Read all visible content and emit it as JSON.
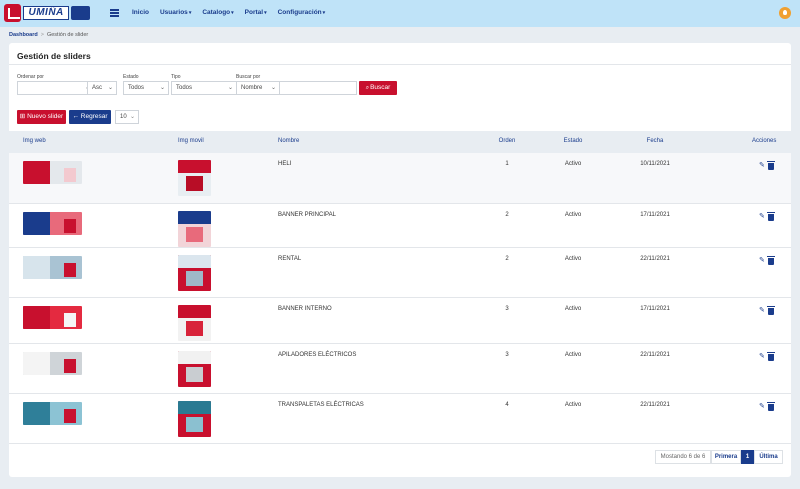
{
  "brand": {
    "logo_text": "UMIÑA"
  },
  "nav": [
    {
      "label": "Inicio",
      "caret": false
    },
    {
      "label": "Usuarios",
      "caret": true
    },
    {
      "label": "Catalogo",
      "caret": true
    },
    {
      "label": "Portal",
      "caret": true
    },
    {
      "label": "Configuración",
      "caret": true
    }
  ],
  "breadcrumb": {
    "root": "Dashboard",
    "current": "Gestión de slider"
  },
  "page": {
    "title": "Gestión de sliders"
  },
  "filters": {
    "order_label": "Ordenar por",
    "order_value": "",
    "order_dir": "Asc",
    "estado_label": "Estado",
    "estado_value": "Todos",
    "tipo_label": "Tipo",
    "tipo_value": "Todos",
    "buscar_label": "Buscar por",
    "buscar_field": "Nombre",
    "search_value": "",
    "search_button": "Buscar"
  },
  "actions": {
    "new_label": "Nuevo slider",
    "back_label": "Regresar",
    "page_size": "10"
  },
  "table": {
    "headers": [
      "Img web",
      "Img movil",
      "Nombre",
      "Orden",
      "Estado",
      "Fecha",
      "Acciones"
    ],
    "rows": [
      {
        "nombre": "HELI",
        "orden": "1",
        "estado": "Activo",
        "fecha": "10/11/2021",
        "web_colors": [
          "#c8102e",
          "#e4e8ec",
          "#f3c9cf"
        ],
        "mov_colors": [
          "#c8102e",
          "#b80d26",
          "#e8eef2"
        ]
      },
      {
        "nombre": "BANNER PRINCIPAL",
        "orden": "2",
        "estado": "Activo",
        "fecha": "17/11/2021",
        "web_colors": [
          "#1a3c8c",
          "#e86a7b",
          "#c8102e"
        ],
        "mov_colors": [
          "#1a3c8c",
          "#e86a7b",
          "#f2d4d8"
        ]
      },
      {
        "nombre": "RENTAL",
        "orden": "2",
        "estado": "Activo",
        "fecha": "22/11/2021",
        "web_colors": [
          "#d7e4ec",
          "#a9c3d3",
          "#c8102e"
        ],
        "mov_colors": [
          "#dbe6ee",
          "#9fb8c8",
          "#c8102e"
        ]
      },
      {
        "nombre": "BANNER INTERNO",
        "orden": "3",
        "estado": "Activo",
        "fecha": "17/11/2021",
        "web_colors": [
          "#c8102e",
          "#e42a40",
          "#f5f5f5"
        ],
        "mov_colors": [
          "#c8102e",
          "#d8233a",
          "#f2f2f2"
        ]
      },
      {
        "nombre": "APILADORES ELÉCTRICOS",
        "orden": "3",
        "estado": "Activo",
        "fecha": "22/11/2021",
        "web_colors": [
          "#f4f4f4",
          "#cfd4d8",
          "#c8102e"
        ],
        "mov_colors": [
          "#f1f1f1",
          "#c9cdd1",
          "#c8102e"
        ]
      },
      {
        "nombre": "TRANSPALETAS ELÉCTRICAS",
        "orden": "4",
        "estado": "Activo",
        "fecha": "22/11/2021",
        "web_colors": [
          "#2f7f99",
          "#8cc3d4",
          "#c8102e"
        ],
        "mov_colors": [
          "#2a7a92",
          "#8bc0d0",
          "#c8102e"
        ]
      }
    ]
  },
  "pagination": {
    "info": "Mostando 6 de 6",
    "first": "Primera",
    "current": "1",
    "last": "Última"
  },
  "colors": {
    "primary": "#1a3c8c",
    "accent": "#c8102e",
    "navbar": "#bfe3f8"
  }
}
